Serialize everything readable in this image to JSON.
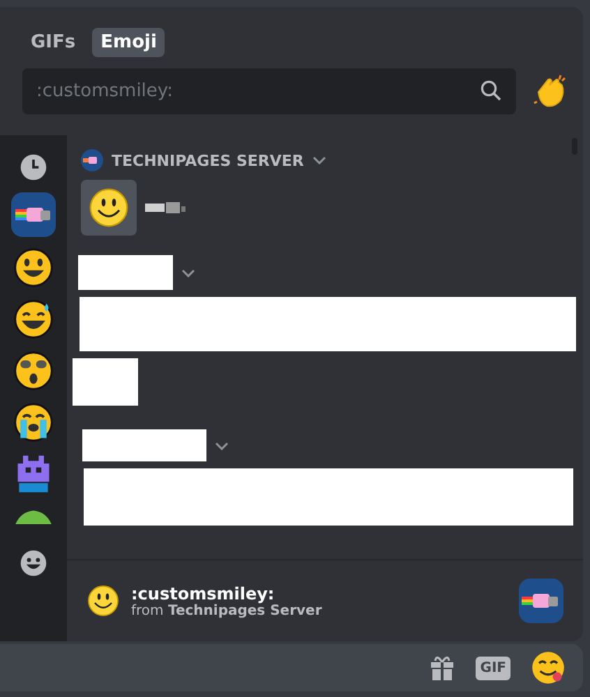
{
  "tabs": [
    {
      "label": "GIFs",
      "selected": false
    },
    {
      "label": "Emoji",
      "selected": true
    }
  ],
  "search": {
    "value": ":customsmiley:"
  },
  "section": {
    "title": "TECHNIPAGES SERVER"
  },
  "preview": {
    "name": ":customsmiley:",
    "source": "from **Technipages Server**"
  },
  "composer": {
    "gif_label": "GIF"
  }
}
